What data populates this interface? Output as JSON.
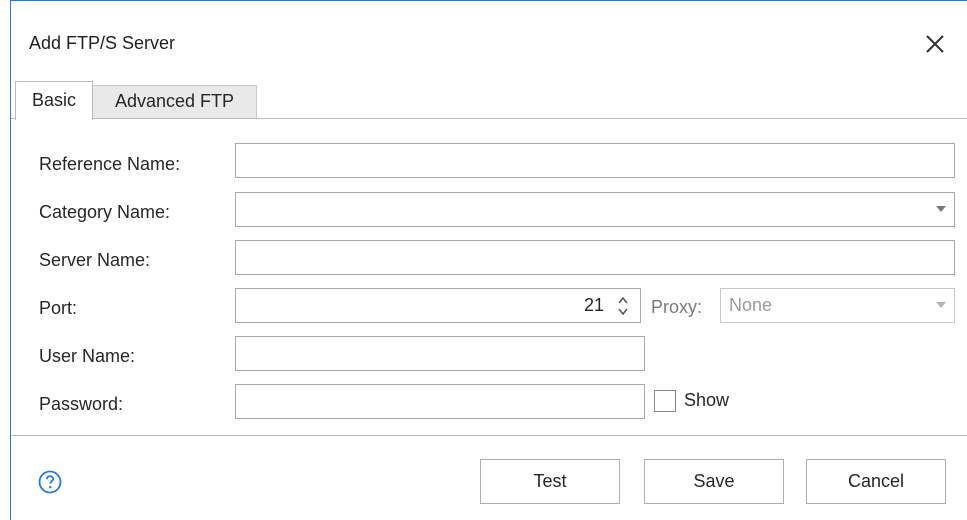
{
  "window": {
    "title": "Add FTP/S Server",
    "close_icon": "close-icon"
  },
  "tabs": [
    {
      "label": "Basic",
      "active": true
    },
    {
      "label": "Advanced FTP",
      "active": false
    }
  ],
  "form": {
    "reference_name": {
      "label": "Reference Name:",
      "value": ""
    },
    "category_name": {
      "label": "Category Name:",
      "value": ""
    },
    "server_name": {
      "label": "Server Name:",
      "value": ""
    },
    "port": {
      "label": "Port:",
      "value": "21"
    },
    "proxy": {
      "label": "Proxy:",
      "value": "None"
    },
    "user_name": {
      "label": "User Name:",
      "value": ""
    },
    "password": {
      "label": "Password:",
      "value": ""
    },
    "show_password": {
      "label": "Show",
      "checked": false
    }
  },
  "footer": {
    "help_icon": "help-icon",
    "test_label": "Test",
    "save_label": "Save",
    "cancel_label": "Cancel"
  },
  "colors": {
    "accent": "#2b79d6",
    "border": "#a9a9a9"
  }
}
